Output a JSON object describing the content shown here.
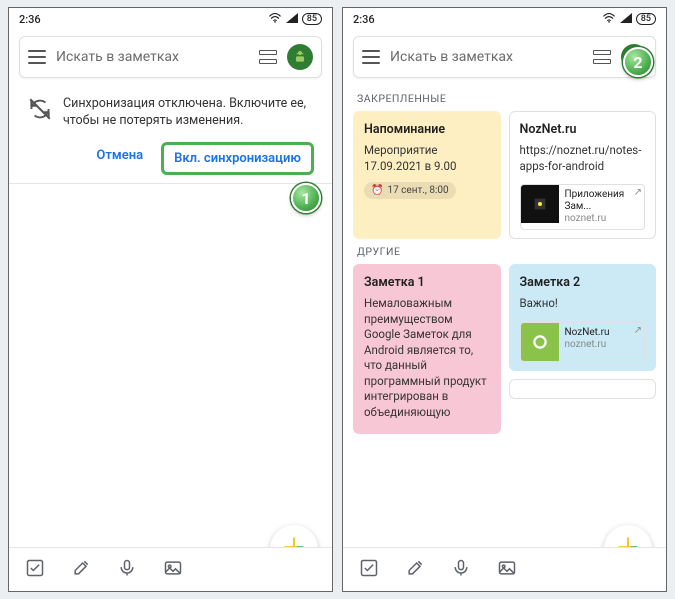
{
  "statusbar": {
    "time": "2:36",
    "battery": "85"
  },
  "search": {
    "placeholder": "Искать в заметках"
  },
  "sync": {
    "message": "Синхронизация отключена. Включите ее, чтобы не потерять изменения.",
    "cancel": "Отмена",
    "enable": "Вкл. синхронизацию"
  },
  "sections": {
    "pinned": "ЗАКРЕПЛЕННЫЕ",
    "others": "ДРУГИЕ"
  },
  "notes": {
    "reminder": {
      "title": "Напоминание",
      "body": "Мероприятие 17.09.2021 в 9.00",
      "chip": "17 сент., 8:00"
    },
    "noznet": {
      "title": "NozNet.ru",
      "body": "https://noznet.ru/notes-apps-for-android",
      "link_title": "Приложения Зам...",
      "link_url": "noznet.ru"
    },
    "note1": {
      "title": "Заметка 1",
      "body": "Немаловажным преимуществом Google Заметок для Android является то, что данный программный продукт интегрирован в объединяющую"
    },
    "note2": {
      "title": "Заметка 2",
      "body": "Важно!",
      "link_title": "NozNet.ru",
      "link_url": "noznet.ru"
    }
  },
  "callouts": {
    "one": "1",
    "two": "2"
  }
}
